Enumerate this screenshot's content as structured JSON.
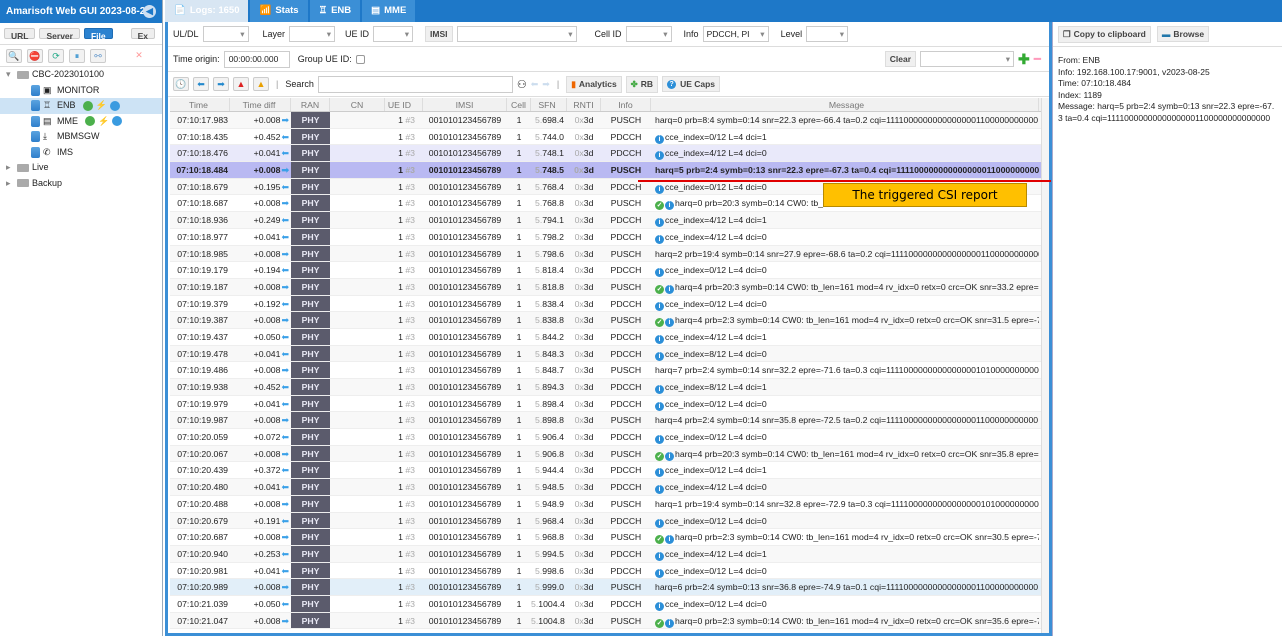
{
  "app": {
    "title": "Amarisoft Web GUI 2023-08-25"
  },
  "sidebar": {
    "sources": [
      "URL",
      "Server",
      "File",
      "Ex"
    ],
    "active_source": "File",
    "tree": [
      {
        "label": "CBC-2023010100",
        "type": "folder",
        "level": 0,
        "open": true
      },
      {
        "label": "MONITOR",
        "level": 1,
        "icon": "terminal-icon"
      },
      {
        "label": "ENB",
        "level": 1,
        "icon": "antenna-icon",
        "selected": true,
        "status": true
      },
      {
        "label": "MME",
        "level": 1,
        "icon": "database-icon",
        "status": true
      },
      {
        "label": "MBMSGW",
        "level": 1,
        "icon": "download-icon"
      },
      {
        "label": "IMS",
        "level": 1,
        "icon": "phone-icon"
      },
      {
        "label": "Live",
        "type": "folder",
        "level": 0
      },
      {
        "label": "Backup",
        "type": "folder",
        "level": 0
      }
    ]
  },
  "tabs": [
    {
      "label": "Logs: 1650",
      "active": true
    },
    {
      "label": "Stats"
    },
    {
      "label": "ENB"
    },
    {
      "label": "MME"
    }
  ],
  "filters": {
    "uldl_label": "UL/DL",
    "layer_label": "Layer",
    "ueid_label": "UE ID",
    "imsi_label": "IMSI",
    "cellid_label": "Cell ID",
    "info_label": "Info",
    "info_value": "PDCCH, PI",
    "level_label": "Level",
    "time_origin_label": "Time origin:",
    "time_origin_value": "00:00:00.000",
    "group_ue_label": "Group UE ID:",
    "clear_label": "Clear",
    "search_label": "Search",
    "analytics_label": "Analytics",
    "rb_label": "RB",
    "uecaps_label": "UE Caps"
  },
  "columns": [
    "Time",
    "Time diff",
    "RAN",
    "CN",
    "UE ID",
    "IMSI",
    "Cell",
    "SFN",
    "RNTI",
    "Info",
    "Message"
  ],
  "rows": [
    [
      "07:10:17.983",
      "+0.008",
      "r",
      "5.",
      "698.4",
      "PUSCH",
      "",
      "harq=0 prb=8:4 symb=0:14 snr=22.3 epre=-66.4 ta=0.2 cqi=11110000000000000001100000000000"
    ],
    [
      "07:10:18.435",
      "+0.452",
      "l",
      "5.",
      "744.0",
      "PDCCH",
      "i",
      "cce_index=0/12 L=4 dci=1"
    ],
    [
      "07:10:18.476",
      "+0.041",
      "l",
      "5.",
      "748.1",
      "PDCCH",
      "i",
      "cce_index=4/12 L=4 dci=0"
    ],
    [
      "07:10:18.484",
      "+0.008",
      "r",
      "5.",
      "748.5",
      "PUSCH",
      "",
      "harq=5 prb=2:4 symb=0:13 snr=22.3 epre=-67.3 ta=0.4 cqi=11110000000000000001100000000000"
    ],
    [
      "07:10:18.679",
      "+0.195",
      "l",
      "5.",
      "768.4",
      "PDCCH",
      "i",
      "cce_index=0/12 L=4 dci=0"
    ],
    [
      "07:10:18.687",
      "+0.008",
      "r",
      "5.",
      "768.8",
      "PUSCH",
      "oki",
      "harq=0 prb=20:3 symb=0:14 CW0: tb_"
    ],
    [
      "07:10:18.936",
      "+0.249",
      "l",
      "5.",
      "794.1",
      "PDCCH",
      "i",
      "cce_index=4/12 L=4 dci=1"
    ],
    [
      "07:10:18.977",
      "+0.041",
      "l",
      "5.",
      "798.2",
      "PDCCH",
      "i",
      "cce_index=4/12 L=4 dci=0"
    ],
    [
      "07:10:18.985",
      "+0.008",
      "r",
      "5.",
      "798.6",
      "PUSCH",
      "",
      "harq=2 prb=19:4 symb=0:14 snr=27.9 epre=-68.6 ta=0.2 cqi=11110000000000000001100000000000"
    ],
    [
      "07:10:19.179",
      "+0.194",
      "l",
      "5.",
      "818.4",
      "PDCCH",
      "i",
      "cce_index=0/12 L=4 dci=0"
    ],
    [
      "07:10:19.187",
      "+0.008",
      "r",
      "5.",
      "818.8",
      "PUSCH",
      "oki",
      "harq=4 prb=20:3 symb=0:14 CW0: tb_len=161 mod=4 rv_idx=0 retx=0 crc=OK snr=33.2 epre=-"
    ],
    [
      "07:10:19.379",
      "+0.192",
      "l",
      "5.",
      "838.4",
      "PDCCH",
      "i",
      "cce_index=0/12 L=4 dci=0"
    ],
    [
      "07:10:19.387",
      "+0.008",
      "r",
      "5.",
      "838.8",
      "PUSCH",
      "oki",
      "harq=4 prb=2:3 symb=0:14 CW0: tb_len=161 mod=4 rv_idx=0 retx=0 crc=OK snr=31.5 epre=-7"
    ],
    [
      "07:10:19.437",
      "+0.050",
      "l",
      "5.",
      "844.2",
      "PDCCH",
      "i",
      "cce_index=4/12 L=4 dci=1"
    ],
    [
      "07:10:19.478",
      "+0.041",
      "l",
      "5.",
      "848.3",
      "PDCCH",
      "i",
      "cce_index=8/12 L=4 dci=0"
    ],
    [
      "07:10:19.486",
      "+0.008",
      "r",
      "5.",
      "848.7",
      "PUSCH",
      "",
      "harq=7 prb=2:4 symb=0:14 snr=32.2 epre=-71.6 ta=0.3 cqi=11110000000000000001010000000000"
    ],
    [
      "07:10:19.938",
      "+0.452",
      "l",
      "5.",
      "894.3",
      "PDCCH",
      "i",
      "cce_index=8/12 L=4 dci=1"
    ],
    [
      "07:10:19.979",
      "+0.041",
      "l",
      "5.",
      "898.4",
      "PDCCH",
      "i",
      "cce_index=0/12 L=4 dci=0"
    ],
    [
      "07:10:19.987",
      "+0.008",
      "r",
      "5.",
      "898.8",
      "PUSCH",
      "",
      "harq=4 prb=2:4 symb=0:14 snr=35.8 epre=-72.5 ta=0.2 cqi=11110000000000000001100000000000"
    ],
    [
      "07:10:20.059",
      "+0.072",
      "l",
      "5.",
      "906.4",
      "PDCCH",
      "i",
      "cce_index=0/12 L=4 dci=0"
    ],
    [
      "07:10:20.067",
      "+0.008",
      "r",
      "5.",
      "906.8",
      "PUSCH",
      "oki",
      "harq=4 prb=20:3 symb=0:14 CW0: tb_len=161 mod=4 rv_idx=0 retx=0 crc=OK snr=35.8 epre=-"
    ],
    [
      "07:10:20.439",
      "+0.372",
      "l",
      "5.",
      "944.4",
      "PDCCH",
      "i",
      "cce_index=0/12 L=4 dci=1"
    ],
    [
      "07:10:20.480",
      "+0.041",
      "l",
      "5.",
      "948.5",
      "PDCCH",
      "i",
      "cce_index=4/12 L=4 dci=0"
    ],
    [
      "07:10:20.488",
      "+0.008",
      "r",
      "5.",
      "948.9",
      "PUSCH",
      "",
      "harq=1 prb=19:4 symb=0:14 snr=32.8 epre=-72.9 ta=0.3 cqi=11110000000000000001010000000000"
    ],
    [
      "07:10:20.679",
      "+0.191",
      "l",
      "5.",
      "968.4",
      "PDCCH",
      "i",
      "cce_index=0/12 L=4 dci=0"
    ],
    [
      "07:10:20.687",
      "+0.008",
      "r",
      "5.",
      "968.8",
      "PUSCH",
      "oki",
      "harq=0 prb=2:3 symb=0:14 CW0: tb_len=161 mod=4 rv_idx=0 retx=0 crc=OK snr=30.5 epre=-7"
    ],
    [
      "07:10:20.940",
      "+0.253",
      "l",
      "5.",
      "994.5",
      "PDCCH",
      "i",
      "cce_index=4/12 L=4 dci=1"
    ],
    [
      "07:10:20.981",
      "+0.041",
      "l",
      "5.",
      "998.6",
      "PDCCH",
      "i",
      "cce_index=0/12 L=4 dci=0"
    ],
    [
      "07:10:20.989",
      "+0.008",
      "r",
      "5.",
      "999.0",
      "PUSCH",
      "",
      "harq=6 prb=2:4 symb=0:13 snr=36.8 epre=-74.9 ta=0.1 cqi=11110000000000000001100000000000"
    ],
    [
      "07:10:21.039",
      "+0.050",
      "l",
      "5.",
      "1004.4",
      "PDCCH",
      "i",
      "cce_index=0/12 L=4 dci=0"
    ],
    [
      "07:10:21.047",
      "+0.008",
      "r",
      "5.",
      "1004.8",
      "PUSCH",
      "oki",
      "harq=0 prb=2:3 symb=0:14 CW0: tb_len=161 mod=4 rv_idx=0 retx=0 crc=OK snr=35.6 epre=-7"
    ]
  ],
  "row_common": {
    "ran": "PHY",
    "ue_id": "1",
    "ue_tag": "#3",
    "imsi": "001010123456789",
    "cell": "1",
    "rnti_prefix": "0x",
    "rnti": "3d"
  },
  "selected_row": 3,
  "highlight_rows": [
    2
  ],
  "hover_rows": [
    28
  ],
  "annotation": {
    "text": "The triggered CSI report",
    "color": "#ffc000",
    "line_color": "#e00000"
  },
  "details": {
    "copy_label": "Copy to clipboard",
    "browse_label": "Browse",
    "text": "From: ENB\nInfo: 192.168.100.17:9001, v2023-08-25\nTime: 07:10:18.484\nIndex: 1189\nMessage: harq=5 prb=2:4 symb=0:13 snr=22.3 epre=-67.3 ta=0.4 cqi=11110000000000000001100000000000000"
  }
}
